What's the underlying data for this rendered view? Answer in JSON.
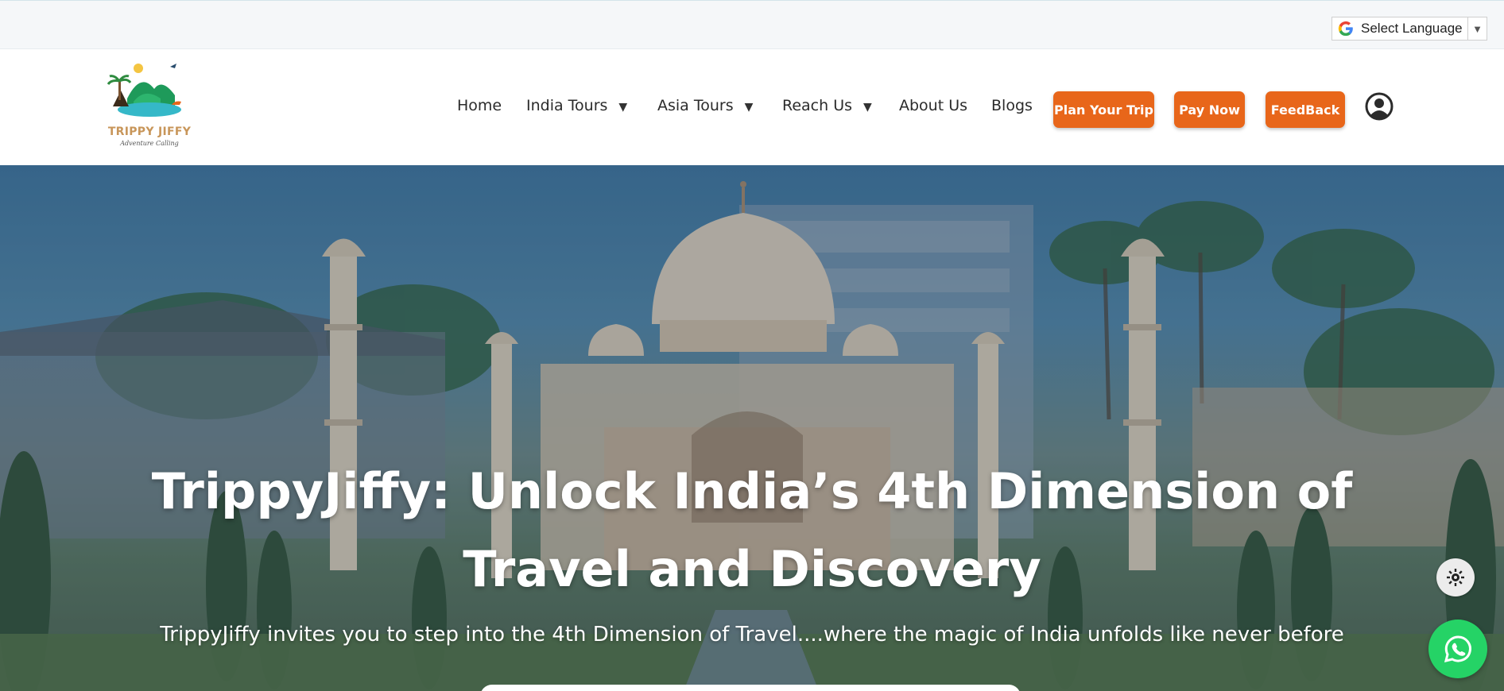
{
  "translate_bar": {
    "select_label": "Select Language",
    "caret": "▼"
  },
  "logo": {
    "name": "TRIPPY JIFFY",
    "tagline": "Adventure Calling"
  },
  "nav": {
    "items": [
      {
        "label": "Home",
        "has_dropdown": false
      },
      {
        "label": "India Tours",
        "has_dropdown": true
      },
      {
        "label": "Asia Tours",
        "has_dropdown": true
      },
      {
        "label": "Reach Us",
        "has_dropdown": true
      },
      {
        "label": "About Us",
        "has_dropdown": false
      },
      {
        "label": "Blogs",
        "has_dropdown": false
      }
    ],
    "caret": "▼",
    "buttons": [
      {
        "label": "Plan Your Trip"
      },
      {
        "label": "Pay Now"
      },
      {
        "label": "FeedBack"
      }
    ],
    "user_icon": "user-circle-icon"
  },
  "hero": {
    "title": "TrippyJiffy: Unlock India’s 4th Dimension of Travel and Discovery",
    "subtitle": "TrippyJiffy invites you to step into the 4th Dimension of Travel....where the magic of India unfolds like never before"
  },
  "floating": {
    "theme_toggle_icon": "sun-gear-icon",
    "whatsapp_icon": "whatsapp-icon"
  },
  "colors": {
    "accent": "#e8661a",
    "whatsapp": "#25d366",
    "logo_text": "#c8965a"
  }
}
